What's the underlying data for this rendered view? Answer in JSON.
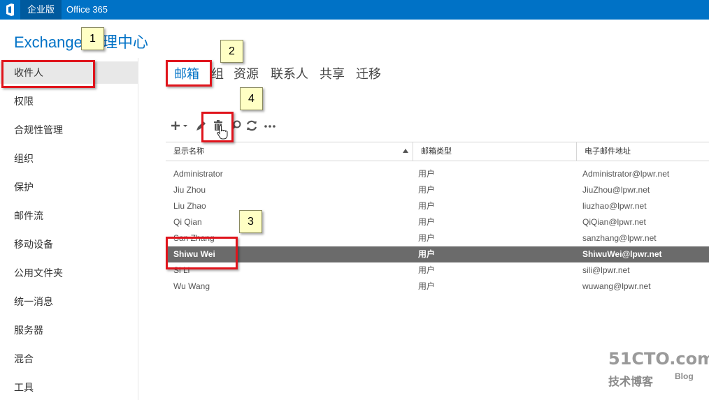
{
  "topbar": {
    "enterprise_label": "企业版",
    "office_label": "Office 365"
  },
  "app": {
    "title": "Exchange 管理中心"
  },
  "sidebar": {
    "items": [
      {
        "label": "收件人"
      },
      {
        "label": "权限"
      },
      {
        "label": "合规性管理"
      },
      {
        "label": "组织"
      },
      {
        "label": "保护"
      },
      {
        "label": "邮件流"
      },
      {
        "label": "移动设备"
      },
      {
        "label": "公用文件夹"
      },
      {
        "label": "统一消息"
      },
      {
        "label": "服务器"
      },
      {
        "label": "混合"
      },
      {
        "label": "工具"
      }
    ],
    "active_index": 0
  },
  "tabs": [
    {
      "label": "邮箱"
    },
    {
      "label": "组"
    },
    {
      "label": "资源"
    },
    {
      "label": "联系人"
    },
    {
      "label": "共享"
    },
    {
      "label": "迁移"
    }
  ],
  "toolbar": {
    "icons": [
      "add-icon",
      "edit-icon",
      "delete-icon",
      "search-icon",
      "refresh-icon",
      "more-icon"
    ]
  },
  "table": {
    "columns": [
      "显示名称",
      "邮箱类型",
      "电子邮件地址"
    ],
    "rows": [
      {
        "name": "Administrator",
        "type": "用户",
        "email": "Administrator@lpwr.net"
      },
      {
        "name": "Jiu Zhou",
        "type": "用户",
        "email": "JiuZhou@lpwr.net"
      },
      {
        "name": "Liu Zhao",
        "type": "用户",
        "email": "liuzhao@lpwr.net"
      },
      {
        "name": "Qi Qian",
        "type": "用户",
        "email": "QiQian@lpwr.net"
      },
      {
        "name": "San Zhang",
        "type": "用户",
        "email": "sanzhang@lpwr.net"
      },
      {
        "name": "Shiwu Wei",
        "type": "用户",
        "email": "ShiwuWei@lpwr.net"
      },
      {
        "name": "Si Li",
        "type": "用户",
        "email": "sili@lpwr.net"
      },
      {
        "name": "Wu Wang",
        "type": "用户",
        "email": "wuwang@lpwr.net"
      }
    ],
    "selected_index": 5
  },
  "callouts": [
    "1",
    "2",
    "3",
    "4"
  ],
  "watermark": {
    "main": "51CTO.com",
    "sub": "技术博客",
    "blog": "Blog"
  },
  "colors": {
    "brand": "#0072c6",
    "selected_row": "#6b6b6b",
    "highlight_border": "#e0141c",
    "callout_bg": "#ffffc4"
  }
}
